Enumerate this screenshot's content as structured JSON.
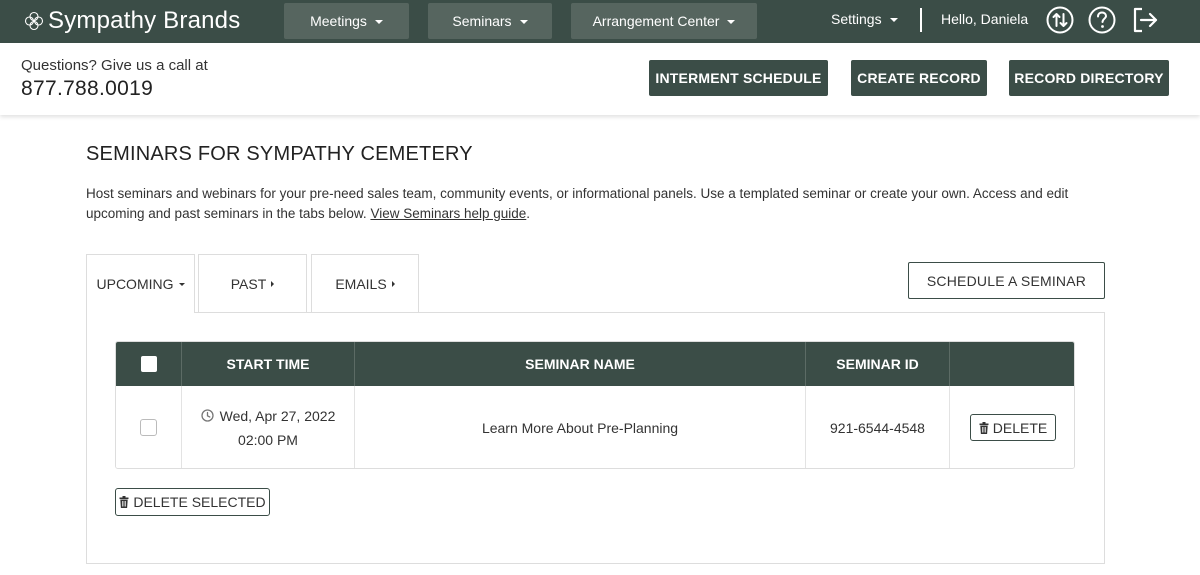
{
  "topnav": {
    "brand": "Sympathy Brands",
    "menus": [
      {
        "label": "Meetings"
      },
      {
        "label": "Seminars"
      },
      {
        "label": "Arrangement Center"
      }
    ],
    "settings_label": "Settings",
    "greeting": "Hello, Daniela",
    "icons": [
      "sync-icon",
      "help-icon",
      "logout-icon"
    ]
  },
  "subheader": {
    "questions": "Questions? Give us a call at",
    "phone": "877.788.0019",
    "buttons": [
      {
        "label": "INTERMENT SCHEDULE"
      },
      {
        "label": "CREATE RECORD"
      },
      {
        "label": "RECORD DIRECTORY"
      }
    ]
  },
  "main": {
    "title": "SEMINARS FOR SYMPATHY CEMETERY",
    "description": "Host seminars and webinars for your pre-need sales team, community events, or informational panels. Use a templated seminar or create your own. Access and edit upcoming and past seminars in the tabs below.",
    "help_link": "View Seminars help guide",
    "help_link_suffix": ".",
    "tabs": [
      {
        "label": "UPCOMING"
      },
      {
        "label": "PAST"
      },
      {
        "label": "EMAILS"
      }
    ],
    "schedule_button": "SCHEDULE A SEMINAR",
    "table": {
      "columns": [
        "",
        "START TIME",
        "SEMINAR NAME",
        "SEMINAR ID",
        ""
      ],
      "rows": [
        {
          "date": "Wed, Apr 27, 2022",
          "time": "02:00 PM",
          "name": "Learn More About Pre-Planning",
          "id": "921-6544-4548",
          "delete_label": "DELETE"
        }
      ]
    },
    "delete_selected": "DELETE SELECTED"
  },
  "colors": {
    "nav_bg": "#3b4d47",
    "nav_button_bg": "#56655f",
    "border": "#dddddd"
  }
}
